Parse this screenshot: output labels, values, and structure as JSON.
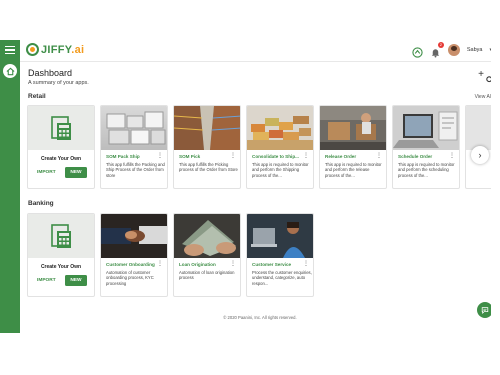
{
  "app": {
    "brand": "JIFFY",
    "brand_suffix": ".ai"
  },
  "header": {
    "user_name": "Sabya",
    "notification_count": "2"
  },
  "page": {
    "title": "Dashboard",
    "subtitle": "A summary of your apps."
  },
  "sections": {
    "retail": {
      "title": "Retail",
      "view_all": "View All",
      "create_card": {
        "title": "Create Your Own",
        "import_label": "IMPORT",
        "new_label": "NEW"
      },
      "apps": [
        {
          "title": "SOM Pack Ship",
          "desc": "This app fulfills the Packing and Ship Process of the Order from store",
          "img": "boxes"
        },
        {
          "title": "SOM Pick",
          "desc": "This app fulfills the Picking process of the Order from Store",
          "img": "aisle"
        },
        {
          "title": "Consolidate to Ship...",
          "desc": "This app is required to monitor and perform the Shipping process of the...",
          "img": "containers"
        },
        {
          "title": "Release Order",
          "desc": "This app is required to monitor and perform the release process of the...",
          "img": "warehouse"
        },
        {
          "title": "Schedule Order",
          "desc": "This app is required to monitor and perform the scheduling process of the...",
          "img": "laptop"
        }
      ]
    },
    "banking": {
      "title": "Banking",
      "create_card": {
        "title": "Create Your Own",
        "import_label": "IMPORT",
        "new_label": "NEW"
      },
      "apps": [
        {
          "title": "Customer Onboarding",
          "desc": "Automation of customer onboarding process, KYC processing",
          "img": "handshake"
        },
        {
          "title": "Loan Origination",
          "desc": "Automation of loan origination process",
          "img": "money"
        },
        {
          "title": "Customer Service",
          "desc": "Process the customer enquiries, understand, categorize, auto respon...",
          "img": "service"
        }
      ]
    }
  },
  "footer": {
    "text": "© 2020 Paanini, Inc. All rights reserved."
  },
  "colors": {
    "brand_green": "#3e8e47",
    "brand_orange": "#f39c1f",
    "title_green": "#3e8e47"
  }
}
